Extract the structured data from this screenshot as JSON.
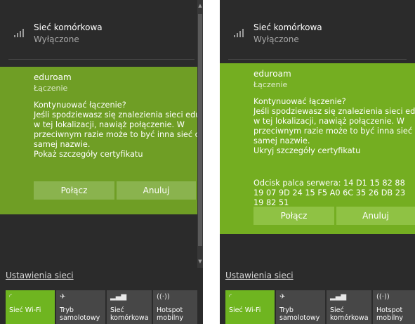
{
  "panels": [
    {
      "cellular": {
        "title": "Sieć komórkowa",
        "status": "Wyłączone"
      },
      "wifi": {
        "name": "eduroam",
        "status": "Łączenie"
      },
      "message": [
        "Kontynuować łączenie?",
        "Jeśli spodziewasz się znalezienia sieci eduroam",
        "w tej lokalizacji, nawiąż połączenie. W",
        "przeciwnym razie może to być inna sieć o tej",
        "samej nazwie.",
        "Pokaż szczegóły certyfikatu"
      ],
      "fingerprint": null,
      "connect": "Połącz",
      "cancel": "Anuluj",
      "settings_link": "Ustawienia sieci",
      "tiles": [
        {
          "label": "Sieć Wi-Fi",
          "icon": "wifi-icon"
        },
        {
          "label": "Tryb samolotowy",
          "icon": "airplane-icon"
        },
        {
          "label": "Sieć komórkowa",
          "icon": "cellular-icon"
        },
        {
          "label": "Hotspot mobilny",
          "icon": "hotspot-icon"
        }
      ]
    },
    {
      "cellular": {
        "title": "Sieć komórkowa",
        "status": "Wyłączone"
      },
      "wifi": {
        "name": "eduroam",
        "status": "Łączenie"
      },
      "message": [
        "Kontynuować łączenie?",
        "Jeśli spodziewasz się znalezienia sieci eduroam",
        "w tej lokalizacji, nawiąż połączenie. W",
        "przeciwnym razie może to być inna sieć o tej",
        "samej nazwie.",
        "Ukryj szczegóły certyfikatu"
      ],
      "fingerprint": "Odcisk palca serwera: 14 D1 15 82 88 19 07 9D 24 15 F5 A0 6C 35 26 DB 23 19 82 51",
      "connect": "Połącz",
      "cancel": "Anuluj",
      "settings_link": "Ustawienia sieci",
      "tiles": [
        {
          "label": "Sieć Wi-Fi",
          "icon": "wifi-icon"
        },
        {
          "label": "Tryb samolotowy",
          "icon": "airplane-icon"
        },
        {
          "label": "Sieć komórkowa",
          "icon": "cellular-icon"
        },
        {
          "label": "Hotspot mobilny",
          "icon": "hotspot-icon"
        }
      ]
    }
  ],
  "colors": {
    "accent": "#6fb520",
    "card_dim": "#6f9e25",
    "card_bright": "#74ae21",
    "panel_bg": "#2b2b2b",
    "tile_bg": "#474747"
  }
}
